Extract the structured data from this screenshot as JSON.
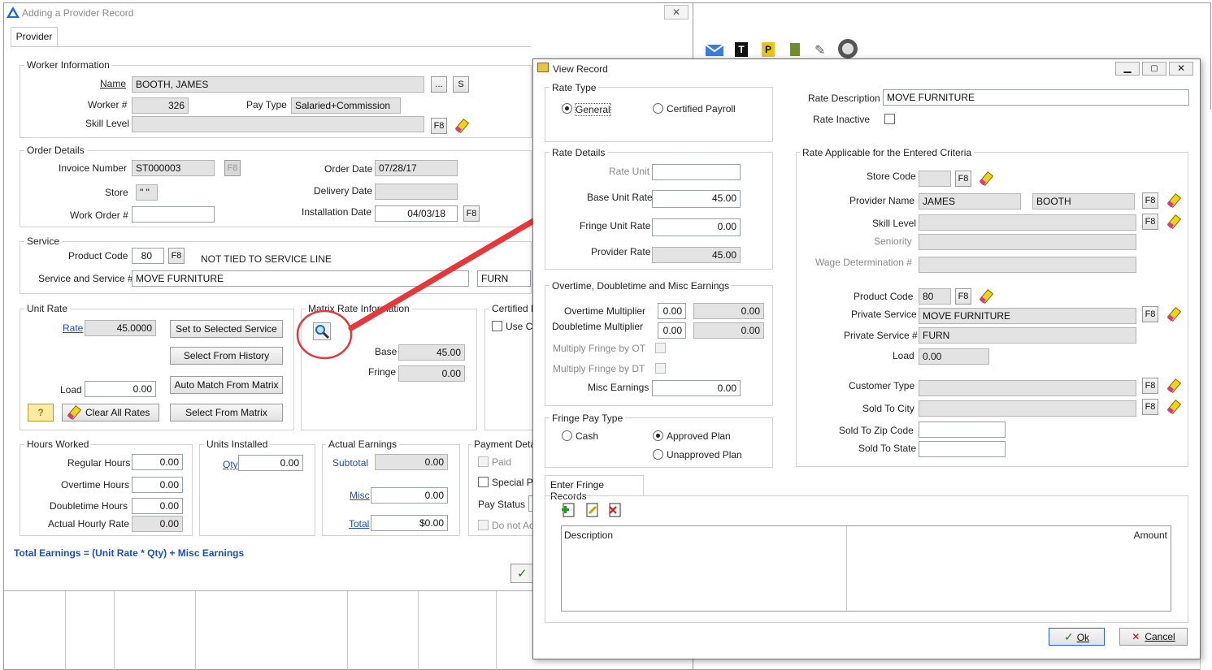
{
  "main_window": {
    "title": "Adding a Provider Record",
    "tab": "Provider",
    "worker": {
      "group": "Worker Information",
      "name_label": "Name",
      "name": "BOOTH, JAMES",
      "ellipsis": "...",
      "s_button": "S",
      "worker_no_label": "Worker #",
      "worker_no": "326",
      "pay_type_label": "Pay Type",
      "pay_type": "Salaried+Commission",
      "skill_label": "Skill Level",
      "skill": "",
      "f8": "F8"
    },
    "order": {
      "group": "Order Details",
      "invoice_label": "Invoice Number",
      "invoice": "ST000003",
      "f8": "F8",
      "order_date_label": "Order Date",
      "order_date": "07/28/17",
      "store_label": "Store",
      "store": "\" \"",
      "delivery_label": "Delivery Date",
      "delivery": "",
      "work_order_label": "Work Order #",
      "work_order": "",
      "install_label": "Installation Date",
      "install": "04/03/18"
    },
    "service": {
      "group": "Service",
      "product_code_label": "Product Code",
      "product_code": "80",
      "f8": "F8",
      "not_tied": "NOT TIED TO SERVICE LINE",
      "service_label": "Service and Service #",
      "service": "MOVE FURNITURE",
      "service_code": "FURN"
    },
    "unit_rate": {
      "group": "Unit Rate",
      "rate_label": "Rate",
      "rate": "45.0000",
      "load_label": "Load",
      "load": "0.00",
      "set_selected": "Set to Selected Service",
      "select_history": "Select From History",
      "auto_match": "Auto Match From Matrix",
      "select_matrix": "Select From Matrix",
      "clear_all": "Clear All Rates",
      "help": "?"
    },
    "matrix": {
      "group": "Matrix Rate Information",
      "base_label": "Base",
      "base": "45.00",
      "fringe_label": "Fringe",
      "fringe": "0.00"
    },
    "certified": {
      "group": "Certified P",
      "use_label": "Use Ce"
    },
    "hours": {
      "group": "Hours Worked",
      "regular_label": "Regular Hours",
      "regular": "0.00",
      "overtime_label": "Overtime Hours",
      "overtime": "0.00",
      "doubletime_label": "Doubletime Hours",
      "doubletime": "0.00",
      "actual_label": "Actual Hourly Rate",
      "actual": "0.00"
    },
    "units": {
      "group": "Units Installed",
      "qty_label": "Qty",
      "qty": "0.00"
    },
    "earnings": {
      "group": "Actual Earnings",
      "subtotal_label": "Subtotal",
      "subtotal": "0.00",
      "misc_label": "Misc",
      "misc": "0.00",
      "total_label": "Total",
      "total": "$0.00"
    },
    "payment": {
      "group": "Payment Deta",
      "paid": "Paid",
      "special": "Special Pe",
      "status_label": "Pay Status",
      "donot": "Do not Ac"
    },
    "formula": "Total Earnings = (Unit Rate * Qty) + Misc Earnings"
  },
  "dialog": {
    "title": "View Record",
    "rate_type": {
      "group": "Rate Type",
      "general": "General",
      "certified": "Certified Payroll"
    },
    "rate_desc_label": "Rate Description",
    "rate_desc": "MOVE FURNITURE",
    "rate_inactive_label": "Rate Inactive",
    "rate_details": {
      "group": "Rate Details",
      "rate_unit_label": "Rate Unit",
      "rate_unit": "",
      "base_label": "Base Unit Rate",
      "base": "45.00",
      "fringe_label": "Fringe Unit Rate",
      "fringe": "0.00",
      "provider_label": "Provider Rate",
      "provider": "45.00"
    },
    "overtime": {
      "group": "Overtime, Doubletime and Misc Earnings",
      "ot_label": "Overtime Multiplier",
      "ot": "0.00",
      "ot_calc": "0.00",
      "dt_label": "Doubletime Multiplier",
      "dt": "0.00",
      "dt_calc": "0.00",
      "mf_ot_label": "Multiply Fringe by OT",
      "mf_dt_label": "Multiply Fringe by DT",
      "misc_label": "Misc Earnings",
      "misc": "0.00"
    },
    "fringe_pay": {
      "group": "Fringe Pay Type",
      "cash": "Cash",
      "approved": "Approved Plan",
      "unapproved": "Unapproved Plan"
    },
    "criteria": {
      "group": "Rate Applicable for the Entered Criteria",
      "store_label": "Store Code",
      "store": "",
      "provider_label": "Provider Name",
      "first": "JAMES",
      "last": "BOOTH",
      "skill_label": "Skill Level",
      "skill": "",
      "seniority_label": "Seniority",
      "seniority": "",
      "wage_label": "Wage Determination #",
      "wage": "",
      "product_label": "Product Code",
      "product": "80",
      "private_service_label": "Private Service",
      "private_service": "MOVE FURNITURE",
      "private_no_label": "Private Service #",
      "private_no": "FURN",
      "load_label": "Load",
      "load": "0.00",
      "customer_label": "Customer Type",
      "customer": "",
      "city_label": "Sold To City",
      "city": "",
      "zip_label": "Sold To Zip Code",
      "zip": "",
      "state_label": "Sold To State",
      "state": "",
      "f8": "F8"
    },
    "fringe_records": {
      "tab": "Enter Fringe Records",
      "col_description": "Description",
      "col_amount": "Amount"
    },
    "ok": "Ok",
    "cancel": "Cancel"
  }
}
